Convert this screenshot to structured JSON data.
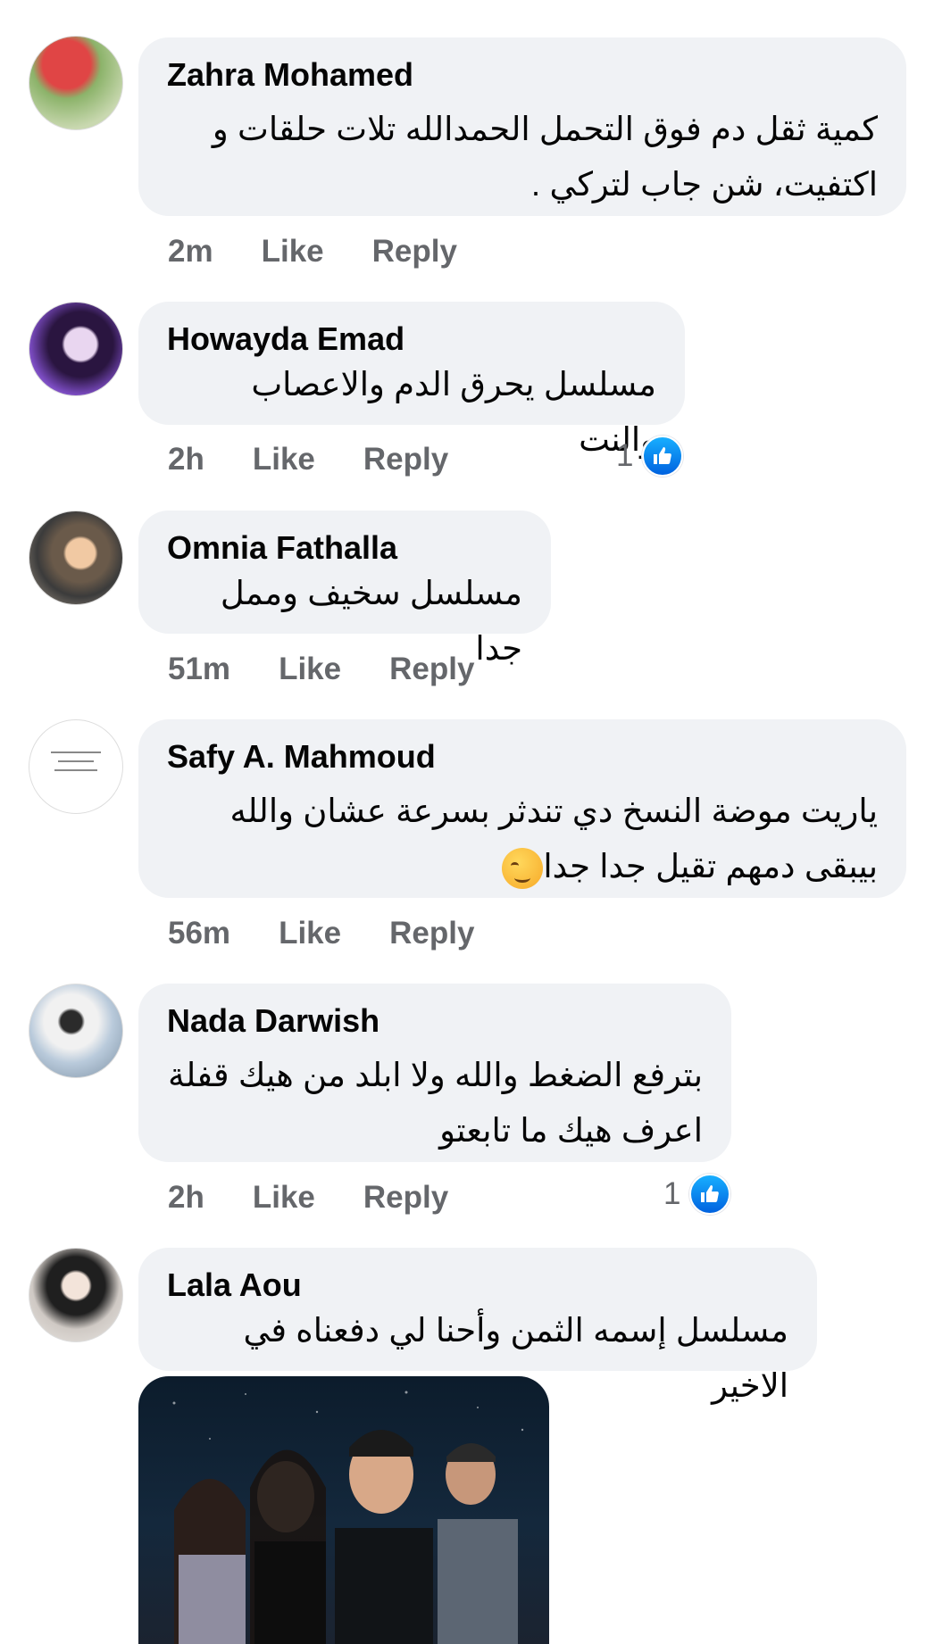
{
  "comments": [
    {
      "name": "Zahra Mohamed",
      "lines": [
        "كمية ثقل دم فوق التحمل الحمدالله تلات حلقات و",
        "اكتفيت، شن جاب لتركي ."
      ],
      "time": "2m",
      "like_label": "Like",
      "reply_label": "Reply",
      "avatar_icon": "tulip-photo-avatar",
      "avatar_color": "#c43a3a"
    },
    {
      "name": "Howayda Emad",
      "lines": [
        "مسلسل يحرق الدم والاعصاب والنت"
      ],
      "time": "2h",
      "like_label": "Like",
      "reply_label": "Reply",
      "reaction_count": "1",
      "avatar_icon": "person-photo-avatar",
      "avatar_color": "#5a2d8c"
    },
    {
      "name": "Omnia Fathalla",
      "lines": [
        "مسلسل سخيف وممل جدا"
      ],
      "time": "51m",
      "like_label": "Like",
      "reply_label": "Reply",
      "avatar_icon": "person-photo-avatar",
      "avatar_color": "#c89a70"
    },
    {
      "name": "Safy A. Mahmoud",
      "lines": [
        "ياريت موضة النسخ دي تندثر بسرعة عشان والله",
        "بيبقى دمهم تقيل جدا جدا"
      ],
      "time": "56m",
      "like_label": "Like",
      "reply_label": "Reply",
      "emoji": "smirk-emoji",
      "avatar_icon": "text-image-avatar",
      "avatar_color": "#ffffff"
    },
    {
      "name": "Nada Darwish",
      "lines": [
        "بترفع الضغط والله ولا ابلد من هيك قفلة",
        "اعرف هيك ما تابعتو"
      ],
      "time": "2h",
      "like_label": "Like",
      "reply_label": "Reply",
      "reaction_count": "1",
      "avatar_icon": "person-photo-avatar",
      "avatar_color": "#9fb6c8"
    },
    {
      "name": "Lala Aou",
      "lines": [
        "مسلسل إسمه الثمن وأحنا لي دفعناه في الاخير"
      ],
      "avatar_icon": "person-photo-avatar",
      "avatar_color": "#d9d4cf"
    }
  ],
  "colors": {
    "bubble": "#f0f2f5",
    "meta_text": "#65676b",
    "like_blue": "#1877f2"
  },
  "attachment": {
    "icon": "tv-series-poster-image"
  }
}
